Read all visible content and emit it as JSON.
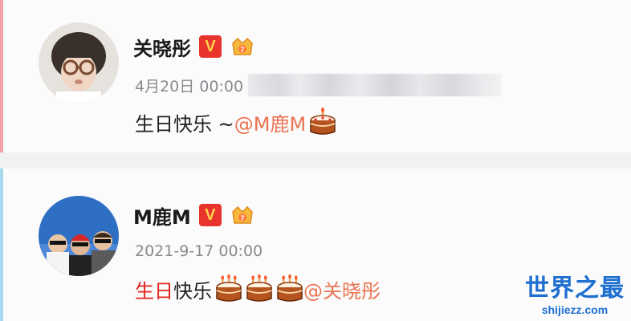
{
  "posts": [
    {
      "author": "关晓彤",
      "verified_badge": "V",
      "time": "4月20日 00:00",
      "content": {
        "text": "生日快乐 ~ ",
        "mention": "@M鹿M",
        "cakes": 1
      }
    },
    {
      "author": "M鹿M",
      "verified_badge": "V",
      "time": "2021-9-17 00:00",
      "content": {
        "text_red": "生日",
        "text": "快乐 ",
        "mention": "@关晓彤",
        "cakes": 3
      }
    }
  ],
  "watermark": {
    "title": "世界之最",
    "url": "shijiezz.com"
  },
  "colors": {
    "mention": "#eb7350",
    "vip_badge": "#e8342c",
    "card1_accent": "#f2a0a8",
    "card2_accent": "#a8d8ee",
    "watermark": "#1e6fd0"
  }
}
